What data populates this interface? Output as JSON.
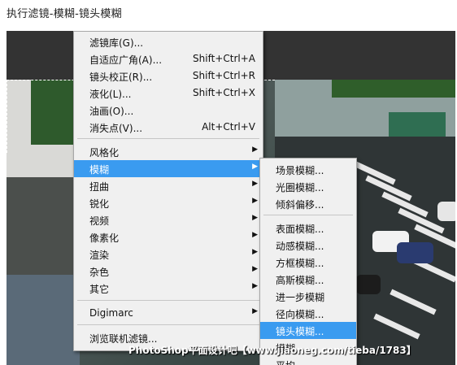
{
  "caption": "执行滤镜-模糊-镜头模糊",
  "filter_menu": {
    "items": [
      {
        "label": "滤镜库(G)...",
        "shortcut": ""
      },
      {
        "label": "自适应广角(A)...",
        "shortcut": "Shift+Ctrl+A"
      },
      {
        "label": "镜头校正(R)...",
        "shortcut": "Shift+Ctrl+R"
      },
      {
        "label": "液化(L)...",
        "shortcut": "Shift+Ctrl+X"
      },
      {
        "label": "油画(O)...",
        "shortcut": ""
      },
      {
        "label": "消失点(V)...",
        "shortcut": "Alt+Ctrl+V"
      },
      {
        "label": "风格化",
        "shortcut": ""
      },
      {
        "label": "模糊",
        "shortcut": ""
      },
      {
        "label": "扭曲",
        "shortcut": ""
      },
      {
        "label": "锐化",
        "shortcut": ""
      },
      {
        "label": "视频",
        "shortcut": ""
      },
      {
        "label": "像素化",
        "shortcut": ""
      },
      {
        "label": "渲染",
        "shortcut": ""
      },
      {
        "label": "杂色",
        "shortcut": ""
      },
      {
        "label": "其它",
        "shortcut": ""
      },
      {
        "label": "Digimarc",
        "shortcut": ""
      },
      {
        "label": "浏览联机滤镜...",
        "shortcut": ""
      }
    ],
    "arrow": "▶"
  },
  "blur_submenu": {
    "items": [
      {
        "label": "场景模糊..."
      },
      {
        "label": "光圈模糊..."
      },
      {
        "label": "倾斜偏移..."
      },
      {
        "label": "表面模糊..."
      },
      {
        "label": "动感模糊..."
      },
      {
        "label": "方框模糊..."
      },
      {
        "label": "高斯模糊..."
      },
      {
        "label": "进一步模糊"
      },
      {
        "label": "径向模糊..."
      },
      {
        "label": "镜头模糊..."
      },
      {
        "label": "模糊"
      },
      {
        "label": "平均"
      }
    ]
  },
  "watermark": "PhotoShop平面设计吧【www.jiaoneg.com/tieba/1783】",
  "colors": {
    "highlight": "#3a9bf0",
    "menu_bg": "#f0f0f0",
    "topbar": "#333333"
  }
}
